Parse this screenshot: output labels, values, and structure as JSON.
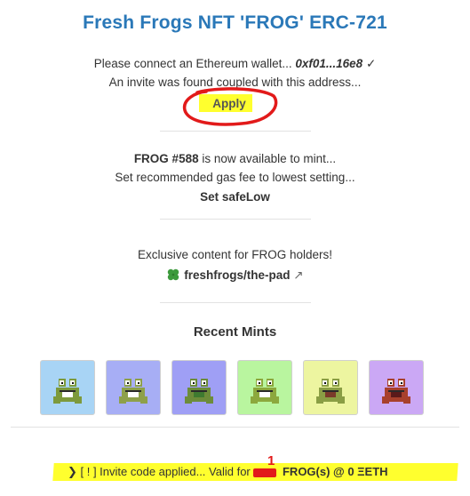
{
  "header": {
    "title": "Fresh Frogs NFT 'FROG' ERC-721"
  },
  "wallet": {
    "connect_text": "Please connect an Ethereum wallet...",
    "address": "0xf01...16e8",
    "check": "✓",
    "invite_text": "An invite was found coupled with this address...",
    "apply_label": "Apply"
  },
  "mint": {
    "token": "FROG #588",
    "available_text": " is now available to mint...",
    "gas_text": "Set recommended gas fee to lowest setting...",
    "safelow_label": "Set safeLow"
  },
  "exclusive": {
    "text": "Exclusive content for FROG holders!",
    "link_label": "freshfrogs/the-pad",
    "external_icon": "↗"
  },
  "recent_mints": {
    "title": "Recent Mints",
    "frogs": [
      {
        "bg": "#a8d4f5",
        "skin": "#7d9a3c",
        "accent": "#ffffff",
        "icon": "frog-image"
      },
      {
        "bg": "#a7aef5",
        "skin": "#8ea04a",
        "accent": "#ffffff",
        "icon": "frog-image"
      },
      {
        "bg": "#9f9ff5",
        "skin": "#6d8c3a",
        "accent": "#3e7a30",
        "icon": "frog-image"
      },
      {
        "bg": "#b9f59f",
        "skin": "#8ca83d",
        "accent": "#ffffff",
        "icon": "frog-image"
      },
      {
        "bg": "#edf5a0",
        "skin": "#8a9e44",
        "accent": "#7a3a2a",
        "icon": "frog-image"
      },
      {
        "bg": "#cba8f5",
        "skin": "#a8402c",
        "accent": "#5a1a1a",
        "icon": "frog-image"
      }
    ]
  },
  "status": {
    "prefix": "❯ [ ! ] Invite code applied... Valid for ",
    "annotation": "1",
    "suffix": " FROG(s) @ 0 ΞETH"
  },
  "colors": {
    "title": "#2a78b8",
    "highlight": "#ffff2e",
    "annotation": "#e21a1a"
  }
}
